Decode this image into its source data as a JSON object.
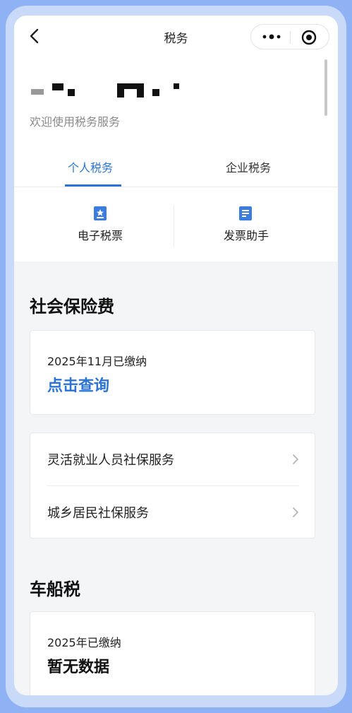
{
  "nav": {
    "title": "税务",
    "back_icon": "chevron-left-icon",
    "more_icon": "more-dots-icon",
    "close_icon": "record-target-icon"
  },
  "header": {
    "welcome": "欢迎使用税务服务"
  },
  "tabs": [
    {
      "label": "个人税务",
      "active": true
    },
    {
      "label": "企业税务",
      "active": false
    }
  ],
  "tools": [
    {
      "label": "电子税票",
      "icon": "ticket-icon"
    },
    {
      "label": "发票助手",
      "icon": "document-icon"
    }
  ],
  "social_insurance": {
    "title": "社会保险费",
    "status": "2025年11月已缴纳",
    "action": "点击查询",
    "services": [
      {
        "label": "灵活就业人员社保服务"
      },
      {
        "label": "城乡居民社保服务"
      }
    ]
  },
  "vehicle_tax": {
    "title": "车船税",
    "status": "2025年已缴纳",
    "value": "暂无数据"
  },
  "colors": {
    "accent": "#2b74d6",
    "frame": "#c9daf8",
    "background": "#8fb2f5"
  }
}
